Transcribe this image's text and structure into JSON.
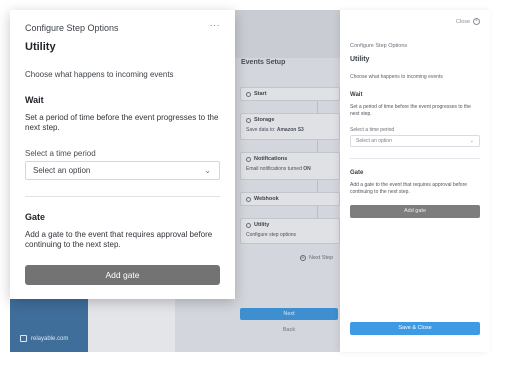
{
  "background_app": {
    "brand": "relayable.com",
    "events_title": "Events Setup",
    "cards": [
      {
        "title": "Start",
        "subtitle": ""
      },
      {
        "title": "Storage",
        "subtitle_prefix": "Save data to:",
        "subtitle_value": "Amazon S3"
      },
      {
        "title": "Notifications",
        "subtitle_prefix": "Email notifications turned",
        "subtitle_value": "ON"
      },
      {
        "title": "Webhook",
        "subtitle": ""
      },
      {
        "title": "Utility",
        "subtitle": "Configure step options"
      }
    ],
    "next_step_link": "Next Step",
    "next_button": "Next",
    "back_button": "Back"
  },
  "panel": {
    "close_label": "Close",
    "kicker": "Configure Step Options",
    "title": "Utility",
    "description": "Choose what happens to incoming events",
    "wait_heading": "Wait",
    "wait_text": "Set a period of time before the event progresses to the next step.",
    "select_label": "Select a time period",
    "select_placeholder": "Select an option",
    "gate_heading": "Gate",
    "gate_text": "Add a gate to the event that requires approval before continuing to the next step.",
    "gate_button": "Add gate",
    "save_button": "Save & Close"
  },
  "modal": {
    "kicker": "Configure Step Options",
    "more_menu": "···",
    "title": "Utility",
    "description": "Choose what happens to incoming events",
    "wait_heading": "Wait",
    "wait_text": "Set a period of time before the event progresses to the next step.",
    "select_label": "Select a time period",
    "select_placeholder": "Select an option",
    "gate_heading": "Gate",
    "gate_text": "Add a gate to the event that requires approval before continuing to the next step.",
    "gate_button": "Add gate"
  },
  "colors": {
    "sidebar": "#3f6e9b",
    "primary_button": "#3d9be6",
    "gate_button": "#737373"
  }
}
